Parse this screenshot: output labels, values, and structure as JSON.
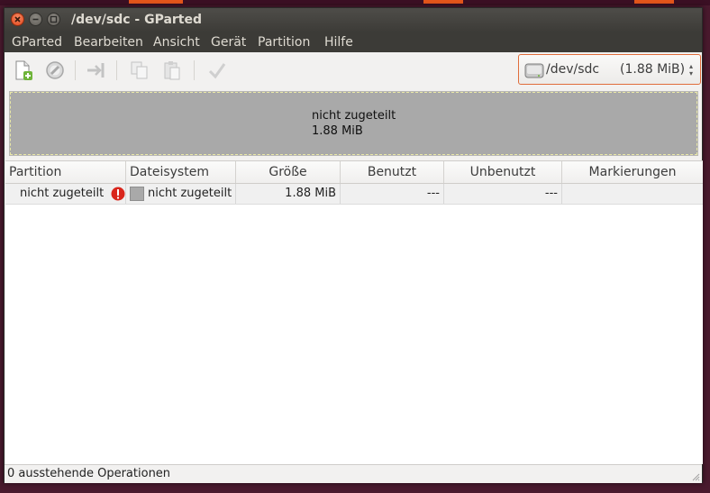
{
  "window": {
    "title": "/dev/sdc - GParted"
  },
  "menu": [
    "GParted",
    "Bearbeiten",
    "Ansicht",
    "Gerät",
    "Partition",
    "Hilfe"
  ],
  "toolbar": {
    "icons": [
      "new-partition-icon",
      "delete-icon",
      "resize-move-icon",
      "copy-icon",
      "paste-icon",
      "apply-icon"
    ]
  },
  "device": {
    "name": "/dev/sdc",
    "size": "(1.88 MiB)"
  },
  "graph": {
    "label": "nicht zugeteilt",
    "size": "1.88 MiB",
    "fill_color": "#a9a9a9"
  },
  "table": {
    "columns": [
      "Partition",
      "Dateisystem",
      "Größe",
      "Benutzt",
      "Unbenutzt",
      "Markierungen"
    ],
    "rows": [
      {
        "partition": "nicht zugeteilt",
        "filesystem": "nicht zugeteilt",
        "size": "1.88 MiB",
        "used": "---",
        "unused": "---",
        "flags": ""
      }
    ]
  },
  "status": {
    "text": "0 ausstehende Operationen"
  },
  "colors": {
    "accent": "#e2461c",
    "titlebar": "#3c3b37"
  }
}
